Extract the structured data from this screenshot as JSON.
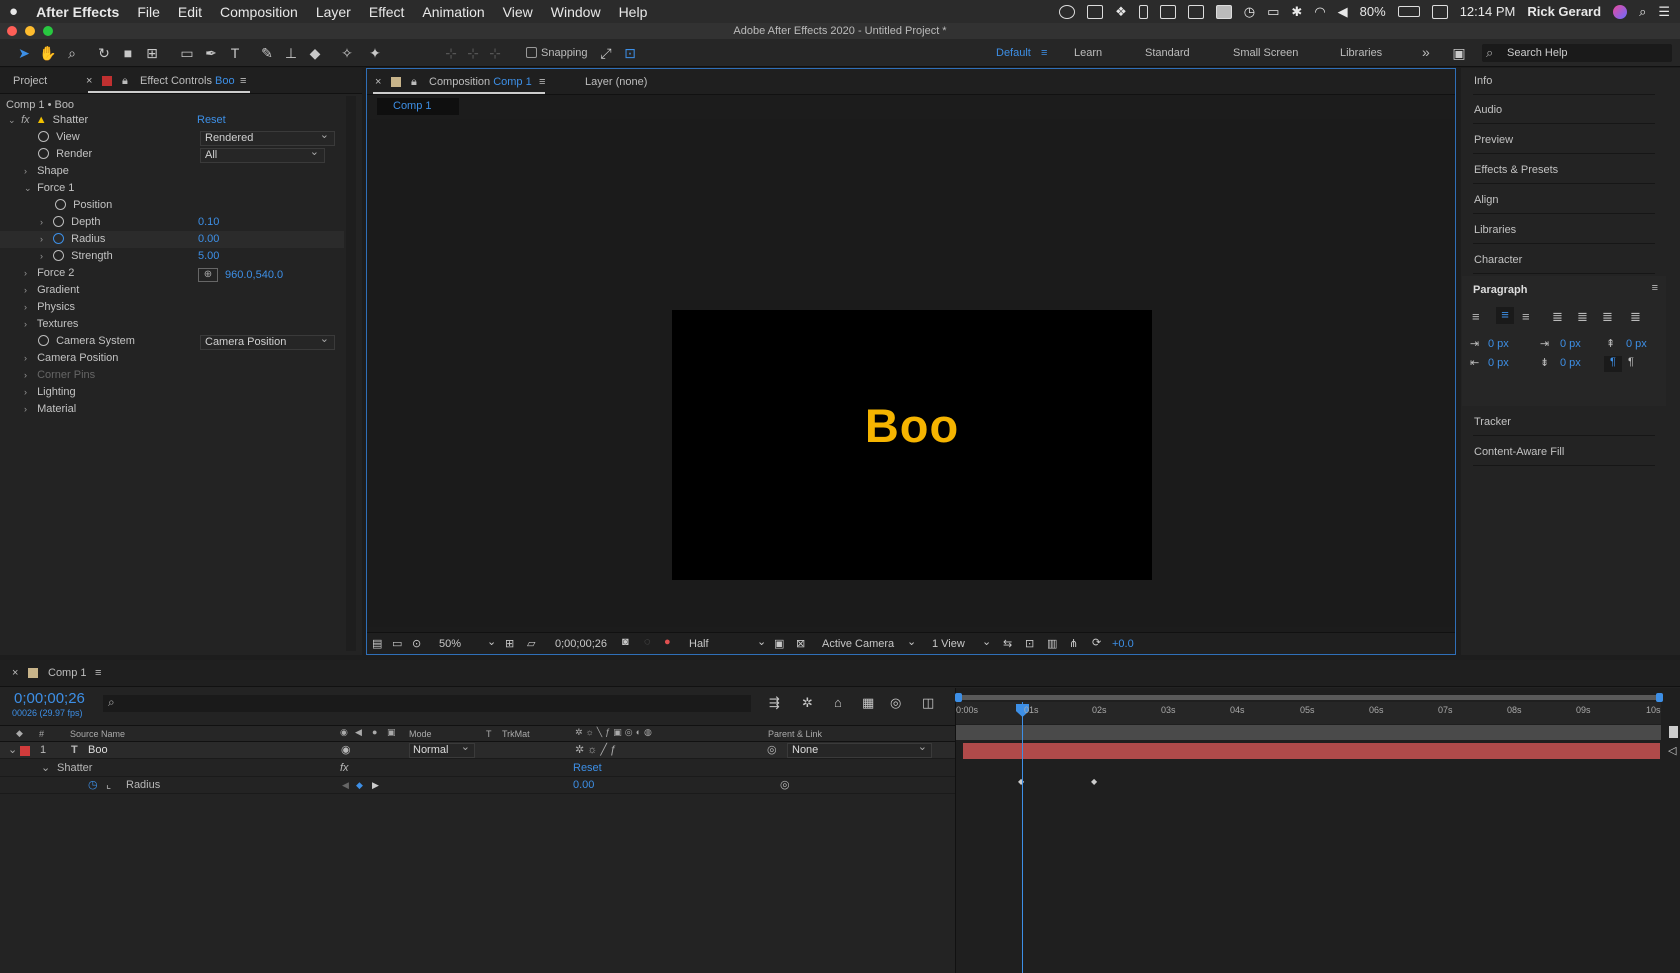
{
  "menubar": {
    "app_name": "After Effects",
    "items": [
      "File",
      "Edit",
      "Composition",
      "Layer",
      "Effect",
      "Animation",
      "View",
      "Window",
      "Help"
    ],
    "battery": "80%",
    "clock": "12:14 PM",
    "user": "Rick Gerard"
  },
  "window": {
    "title": "Adobe After Effects 2020 - Untitled Project *"
  },
  "toolbar": {
    "snapping_label": "Snapping",
    "workspaces": [
      "Default",
      "Learn",
      "Standard",
      "Small Screen",
      "Libraries"
    ],
    "search_placeholder": "Search Help"
  },
  "effect_controls": {
    "tab_project": "Project",
    "tab_label": "Effect Controls",
    "tab_layer": "Boo",
    "breadcrumb": "Comp 1 • Boo",
    "effect_name": "Shatter",
    "reset_label": "Reset",
    "view_label": "View",
    "view_value": "Rendered",
    "render_label": "Render",
    "render_value": "All",
    "shape_label": "Shape",
    "force1_label": "Force 1",
    "position_label": "Position",
    "position_value": "960.0,540.0",
    "depth_label": "Depth",
    "depth_value": "0.10",
    "radius_label": "Radius",
    "radius_value": "0.00",
    "strength_label": "Strength",
    "strength_value": "5.00",
    "force2_label": "Force 2",
    "gradient_label": "Gradient",
    "physics_label": "Physics",
    "textures_label": "Textures",
    "camera_system_label": "Camera System",
    "camera_system_value": "Camera Position",
    "camera_position_label": "Camera Position",
    "corner_pins_label": "Corner Pins",
    "lighting_label": "Lighting",
    "material_label": "Material"
  },
  "composition": {
    "tab_label": "Composition",
    "tab_comp": "Comp 1",
    "layer_tab": "Layer (none)",
    "sub_tab": "Comp 1",
    "canvas_text": "Boo",
    "canvas_text_color": "#f5b400",
    "zoom": "50%",
    "timecode": "0;00;00;26",
    "resolution": "Half",
    "camera": "Active Camera",
    "views": "1 View",
    "exposure": "+0.0"
  },
  "right_panel": {
    "items": [
      "Info",
      "Audio",
      "Preview",
      "Effects & Presets",
      "Align",
      "Libraries",
      "Character"
    ],
    "paragraph_title": "Paragraph",
    "indent_values": [
      "0 px",
      "0 px",
      "0 px",
      "0 px",
      "0 px"
    ],
    "tracker": "Tracker",
    "content_aware_fill": "Content-Aware Fill"
  },
  "timeline": {
    "comp_tab": "Comp 1",
    "timecode": "0;00;00;26",
    "frame_info": "00026 (29.97 fps)",
    "col_hash": "#",
    "col_source": "Source Name",
    "col_mode": "Mode",
    "col_t": "T",
    "col_trkmat": "TrkMat",
    "col_parent": "Parent & Link",
    "layer_number": "1",
    "layer_type": "T",
    "layer_name": "Boo",
    "layer_mode": "Normal",
    "layer_parent": "None",
    "effect_name": "Shatter",
    "effect_reset": "Reset",
    "prop_name": "Radius",
    "prop_value": "0.00",
    "ruler_ticks": [
      "0:00s",
      "01s",
      "02s",
      "03s",
      "04s",
      "05s",
      "06s",
      "07s",
      "08s",
      "09s",
      "10s"
    ],
    "layer_bar_color": "#b04a4a",
    "label_color": "#d03b3b"
  }
}
